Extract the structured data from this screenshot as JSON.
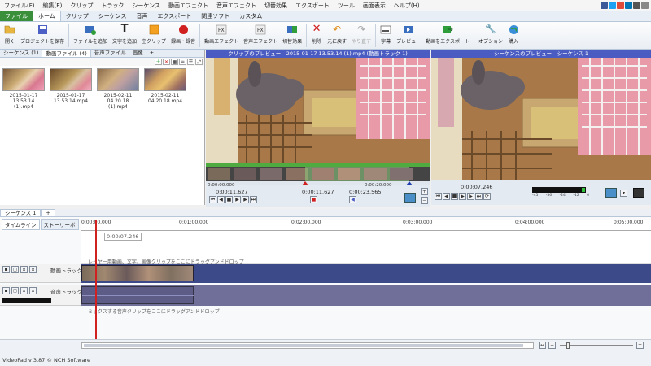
{
  "menu": [
    "ファイル(F)",
    "編集(E)",
    "クリップ",
    "トラック",
    "シーケンス",
    "動画エフェクト",
    "音声エフェクト",
    "切替効果",
    "エクスポート",
    "ツール",
    "画面表示",
    "ヘルプ(H)"
  ],
  "ribbon_tabs": {
    "file": "ファイル",
    "items": [
      "ホーム",
      "クリップ",
      "シーケンス",
      "音声",
      "エクスポート",
      "関連ソフト",
      "カスタム"
    ]
  },
  "toolbar": {
    "open": "開く",
    "save_project": "プロジェクトを保存",
    "add_files": "ファイルを追加",
    "add_text": "文字を追加",
    "blank_clip": "空クリップ",
    "record": "録画・録音",
    "video_effects": "動画エフェクト",
    "audio_effects": "音声エフェクト",
    "transitions": "切替効果",
    "delete": "削除",
    "undo": "元に戻す",
    "redo": "やり直す",
    "subtitles": "字幕",
    "preview": "プレビュー",
    "export": "動画をエクスポート",
    "options": "オプション",
    "buy": "購入"
  },
  "bin": {
    "tabs": [
      "シーケンス (1)",
      "動画ファイル (4)",
      "音声ファイル",
      "画像",
      "+"
    ],
    "clips": [
      {
        "date": "2015-01-17",
        "name": "13.53.14 (1).mp4"
      },
      {
        "date": "2015-01-17",
        "name": "13.53.14.mp4"
      },
      {
        "date": "2015-02-11",
        "name": "04.20.18 (1).mp4"
      },
      {
        "date": "2015-02-11",
        "name": "04.20.18.mp4"
      }
    ]
  },
  "clip_preview": {
    "title": "クリップのプレビュー - 2015-01-17 13.53.14 (1).mp4 (動画トラック 1)",
    "time_start": "0:00:00.000",
    "time_end": "0:00:20.000",
    "current": "0:00:11.627",
    "in_point": "0:00:11.627",
    "duration": "0:00:23.565"
  },
  "seq_preview": {
    "title": "シーケンスのプレビュー - シーケンス 1",
    "current": "0:00:07.246",
    "meter_labels": [
      "-45",
      "-36",
      "-24",
      "-12",
      "0"
    ]
  },
  "sequence_tabs": [
    "シーケンス 1",
    "+"
  ],
  "timeline": {
    "tabs": [
      "タイムライン",
      "ストーリーボ"
    ],
    "ruler": [
      "0:00:00.000",
      "0:01:00.000",
      "0:02:00.000",
      "0:03:00.000",
      "0:04:00.000",
      "0:05:00.000"
    ],
    "playhead_tooltip": "0:00:07.246",
    "overlay_hint": "レイヤー用動画、文字、画像クリップをここにドラッグアンドドロップ",
    "video_track": "動画トラック 1",
    "audio_track": "音声トラック 1",
    "audio_hint": "ミックスする音声クリップをここにドラッグアンドドロップ"
  },
  "status": {
    "version": "VideoPad v 3.87 © NCH Software"
  },
  "colors": {
    "accent": "#4a5cc2",
    "file_tab": "#3a8f3a",
    "record": "#d02020",
    "video_track": "#3d4a8a",
    "audio_track": "#6f6f9a"
  }
}
